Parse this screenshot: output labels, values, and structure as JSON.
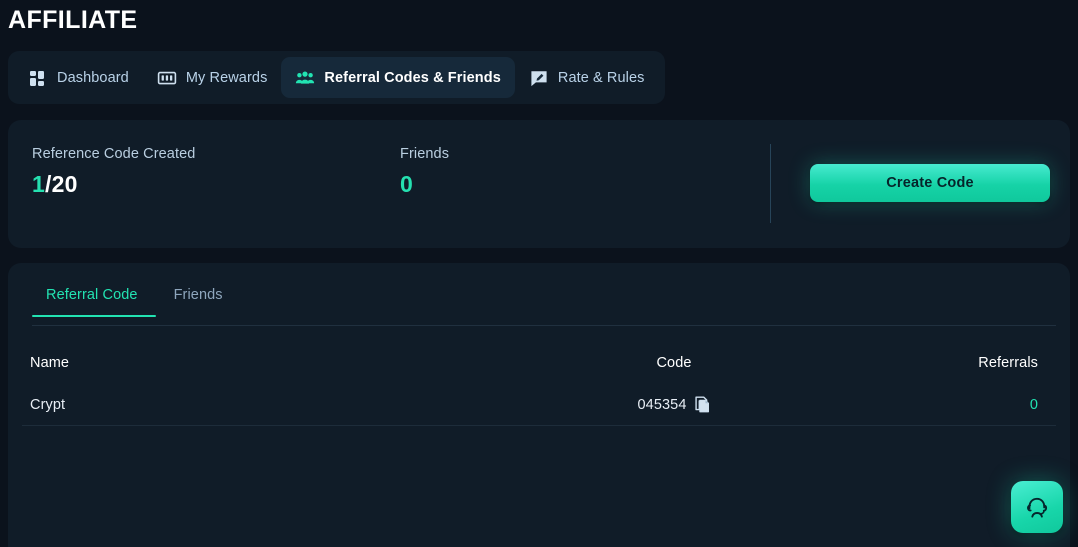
{
  "page": {
    "title": "AFFILIATE"
  },
  "nav": {
    "tabs": [
      {
        "label": "Dashboard",
        "icon": "dashboard-grid-icon",
        "active": false
      },
      {
        "label": "My Rewards",
        "icon": "banknote-icon",
        "active": false
      },
      {
        "label": "Referral Codes & Friends",
        "icon": "people-group-icon",
        "active": true
      },
      {
        "label": "Rate & Rules",
        "icon": "speech-bubble-edit-icon",
        "active": false
      }
    ]
  },
  "stats": {
    "reference_code": {
      "label": "Reference Code Created",
      "current": "1",
      "total": "/20"
    },
    "friends": {
      "label": "Friends",
      "value": "0"
    },
    "create_button": "Create Code"
  },
  "panel": {
    "subtabs": [
      {
        "label": "Referral Code",
        "active": true
      },
      {
        "label": "Friends",
        "active": false
      }
    ],
    "table": {
      "columns": [
        "Name",
        "Code",
        "Referrals"
      ],
      "rows": [
        {
          "name": "Crypt",
          "code": "045354",
          "referrals": "0"
        }
      ]
    }
  },
  "support": {
    "icon": "headset-support-icon"
  },
  "colors": {
    "accent": "#22e3b2",
    "page_bg": "#0b121c",
    "card_bg": "#101c28",
    "tab_active_bg": "#16293a",
    "text_primary": "#ffffff",
    "text_muted": "#8ea6bd"
  }
}
